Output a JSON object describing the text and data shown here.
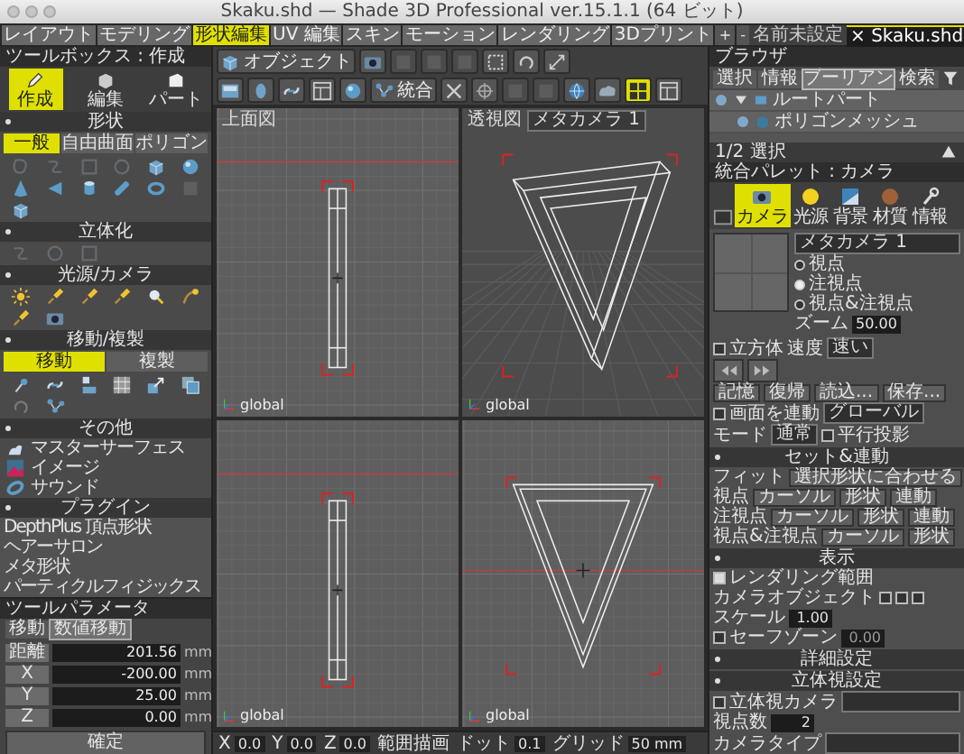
{
  "window": {
    "title": "Skaku.shd — Shade 3D Professional ver.15.1.1 (64 ビット)"
  },
  "mode_tabs": [
    {
      "label": "レイアウト",
      "selected": false
    },
    {
      "label": "モデリング",
      "selected": false
    },
    {
      "label": "形状編集",
      "selected": true
    },
    {
      "label": "UV 編集",
      "selected": false
    },
    {
      "label": "スキン",
      "selected": false
    },
    {
      "label": "モーション",
      "selected": false
    },
    {
      "label": "レンダリング",
      "selected": false
    },
    {
      "label": "3Dプリント",
      "selected": false
    }
  ],
  "tab_buttons": [
    "+",
    "-"
  ],
  "documents": [
    {
      "label": "名前未設定",
      "selected": false
    },
    {
      "label": "Skaku.shd",
      "close": "×",
      "selected": true
    }
  ],
  "toolbox": {
    "title": "ツールボックス : 作成",
    "modes": [
      {
        "label": "作成",
        "selected": true
      },
      {
        "label": "編集",
        "selected": false
      },
      {
        "label": "パート",
        "selected": false
      }
    ],
    "sections": [
      {
        "title": "形状",
        "tabs": [
          {
            "label": "一般",
            "selected": true
          },
          {
            "label": "自由曲面",
            "selected": false
          },
          {
            "label": "ポリゴン",
            "selected": false
          }
        ],
        "icons": [
          {
            "disabled": true
          },
          {
            "disabled": true
          },
          {
            "disabled": true
          },
          {
            "disabled": true
          },
          {
            "disabled": false
          },
          {
            "disabled": false
          },
          {
            "disabled": false
          },
          {
            "disabled": false
          },
          {
            "disabled": false
          },
          {
            "disabled": false
          },
          {
            "disabled": false
          },
          {
            "disabled": true
          },
          {
            "disabled": false
          }
        ]
      },
      {
        "title": "立体化",
        "icons": [
          {
            "disabled": true
          },
          {
            "disabled": true
          },
          {
            "disabled": true
          }
        ]
      },
      {
        "title": "光源/カメラ",
        "icons": [
          {
            "disabled": false
          },
          {
            "disabled": false
          },
          {
            "disabled": false
          },
          {
            "disabled": false
          },
          {
            "disabled": false
          },
          {
            "disabled": false
          },
          {
            "disabled": false
          },
          {
            "disabled": false
          }
        ]
      },
      {
        "title": "移動/複製",
        "tabs": [
          {
            "label": "移動",
            "selected": true
          },
          {
            "label": "複製",
            "selected": false
          }
        ],
        "icons": [
          {
            "disabled": false
          },
          {
            "disabled": false
          },
          {
            "disabled": false
          },
          {
            "disabled": false
          },
          {
            "disabled": false
          },
          {
            "disabled": false
          },
          {
            "disabled": true
          },
          {
            "disabled": false
          }
        ]
      },
      {
        "title": "その他",
        "items": [
          "マスターサーフェス",
          "イメージ",
          "サウンド"
        ]
      },
      {
        "title": "プラグイン",
        "plugins": [
          "DepthPlus 頂点形状",
          "ヘアーサロン",
          "メタ形状",
          "パーティクルフィジックス"
        ]
      }
    ]
  },
  "tool_parameters": {
    "title": "ツールパラメータ",
    "tabs": [
      {
        "label": "移動",
        "selected": false
      },
      {
        "label": "数値移動",
        "selected": true
      }
    ],
    "fields": [
      {
        "label": "距離",
        "value": "201.56",
        "unit": "mm"
      },
      {
        "label": "X",
        "value": "-200.00",
        "unit": "mm"
      },
      {
        "label": "Y",
        "value": "25.00",
        "unit": "mm"
      },
      {
        "label": "Z",
        "value": "0.00",
        "unit": "mm"
      }
    ],
    "button": "確定"
  },
  "toolbar": [
    [
      {
        "kind": "button",
        "label": "オブジェクト",
        "disabled": false,
        "selected": false
      },
      {
        "kind": "icon",
        "disabled": false,
        "selected": false
      },
      {
        "kind": "icon",
        "disabled": true,
        "selected": false
      },
      {
        "kind": "icon",
        "disabled": true,
        "selected": false
      },
      {
        "kind": "icon",
        "disabled": true,
        "selected": false
      },
      {
        "kind": "icon",
        "disabled": false,
        "selected": false
      },
      {
        "kind": "icon",
        "disabled": false,
        "selected": false
      },
      {
        "kind": "icon",
        "disabled": false,
        "selected": false
      }
    ],
    [
      {
        "kind": "icon",
        "disabled": false,
        "selected": false
      },
      {
        "kind": "icon",
        "disabled": false,
        "selected": false
      },
      {
        "kind": "icon",
        "disabled": false,
        "selected": false
      },
      {
        "kind": "icon",
        "disabled": false,
        "selected": false
      },
      {
        "kind": "icon",
        "disabled": false,
        "selected": false
      },
      {
        "kind": "button",
        "label": "統合",
        "disabled": false,
        "selected": false
      },
      {
        "kind": "icon",
        "disabled": false,
        "selected": false
      },
      {
        "kind": "icon",
        "disabled": false,
        "selected": false
      },
      {
        "kind": "icon",
        "disabled": true,
        "selected": false
      },
      {
        "kind": "icon",
        "disabled": true,
        "selected": false
      },
      {
        "kind": "icon",
        "disabled": false,
        "selected": false
      },
      {
        "kind": "icon",
        "disabled": false,
        "selected": false
      },
      {
        "kind": "icon",
        "disabled": false,
        "selected": true
      },
      {
        "kind": "icon",
        "disabled": false,
        "selected": false
      }
    ]
  ],
  "viewports": [
    {
      "kind": "side",
      "label": "上面図",
      "axis_label": "global"
    },
    {
      "kind": "perspective",
      "label": "透視図",
      "camera": "メタカメラ 1",
      "axis_label": "global"
    },
    {
      "kind": "side",
      "axis_label": "global"
    },
    {
      "kind": "front",
      "axis_label": "global"
    }
  ],
  "status_bar": [
    {
      "label": "X",
      "value": "0.0"
    },
    {
      "label": "Y",
      "value": "0.0"
    },
    {
      "label": "Z",
      "value": "0.0"
    },
    {
      "label": "範囲描画"
    },
    {
      "label": "ドット",
      "value": "0.1"
    },
    {
      "label": "グリッド",
      "value": "50 mm"
    }
  ],
  "browser": {
    "title": "ブラウザ",
    "tabs": [
      {
        "label": "選択",
        "selected": false
      },
      {
        "label": "情報",
        "selected": false
      },
      {
        "label": "ブーリアン",
        "selected": true
      },
      {
        "label": "検索",
        "selected": false
      }
    ],
    "tree": [
      {
        "label": "ルートパート",
        "expanded": true,
        "children": [
          {
            "label": "ポリゴンメッシュ"
          }
        ]
      }
    ],
    "status": "1/2 選択"
  },
  "palette": {
    "title": "統合パレット : カメラ",
    "tabs": [
      {
        "label": "カメラ",
        "selected": true
      },
      {
        "label": "光源",
        "selected": false
      },
      {
        "label": "背景",
        "selected": false
      },
      {
        "label": "材質",
        "selected": false
      },
      {
        "label": "情報",
        "selected": false
      }
    ]
  },
  "camera": {
    "camera_select": "メタカメラ 1",
    "views": [
      {
        "label": "視点",
        "selected": false
      },
      {
        "label": "注視点",
        "selected": true
      },
      {
        "label": "視点&注視点",
        "selected": false
      }
    ],
    "zoom": {
      "label": "ズーム",
      "value": "50.00"
    },
    "cube": {
      "label": "立方体",
      "checked": false
    },
    "speed": {
      "label": "速度",
      "value": "速い"
    },
    "rows": [
      {
        "kind": "buttons",
        "items": [
          "記憶",
          "復帰",
          "読込...",
          "保存..."
        ]
      },
      {
        "kind": "check_select",
        "label": "画面を連動",
        "checked": false,
        "value": "グローバル"
      },
      {
        "kind": "select_check",
        "label": "モード",
        "value": "通常",
        "check_label": "平行投影",
        "checked": false
      },
      {
        "kind": "section",
        "title": "セット&連動"
      },
      {
        "kind": "label_buttons",
        "label": "フィット",
        "items": [
          "選択形状に合わせる"
        ]
      },
      {
        "kind": "label_buttons",
        "label": "視点",
        "items": [
          "カーソル",
          "形状",
          "連動"
        ]
      },
      {
        "kind": "label_buttons",
        "label": "注視点",
        "items": [
          "カーソル",
          "形状",
          "連動"
        ]
      },
      {
        "kind": "label_buttons",
        "label": "視点&注視点",
        "items": [
          "カーソル",
          "形状"
        ]
      },
      {
        "kind": "section",
        "title": "表示"
      },
      {
        "kind": "check",
        "label": "レンダリング範囲",
        "checked": true
      },
      {
        "kind": "label_checks",
        "label": "カメラオブジェクト",
        "checks": [
          {
            "checked": false
          },
          {
            "checked": false
          },
          {
            "checked": false
          }
        ]
      },
      {
        "kind": "field",
        "label": "スケール",
        "value": "1.00"
      },
      {
        "kind": "check_value",
        "label": "セーフゾーン",
        "checked": false,
        "value": "0.00"
      },
      {
        "kind": "section",
        "title": "詳細設定"
      },
      {
        "kind": "section",
        "title": "立体視設定"
      },
      {
        "kind": "check_select",
        "label": "立体視カメラ",
        "checked": false
      },
      {
        "kind": "field",
        "label": "視点数",
        "value": "2"
      },
      {
        "kind": "select",
        "label": "カメラタイプ"
      }
    ]
  }
}
